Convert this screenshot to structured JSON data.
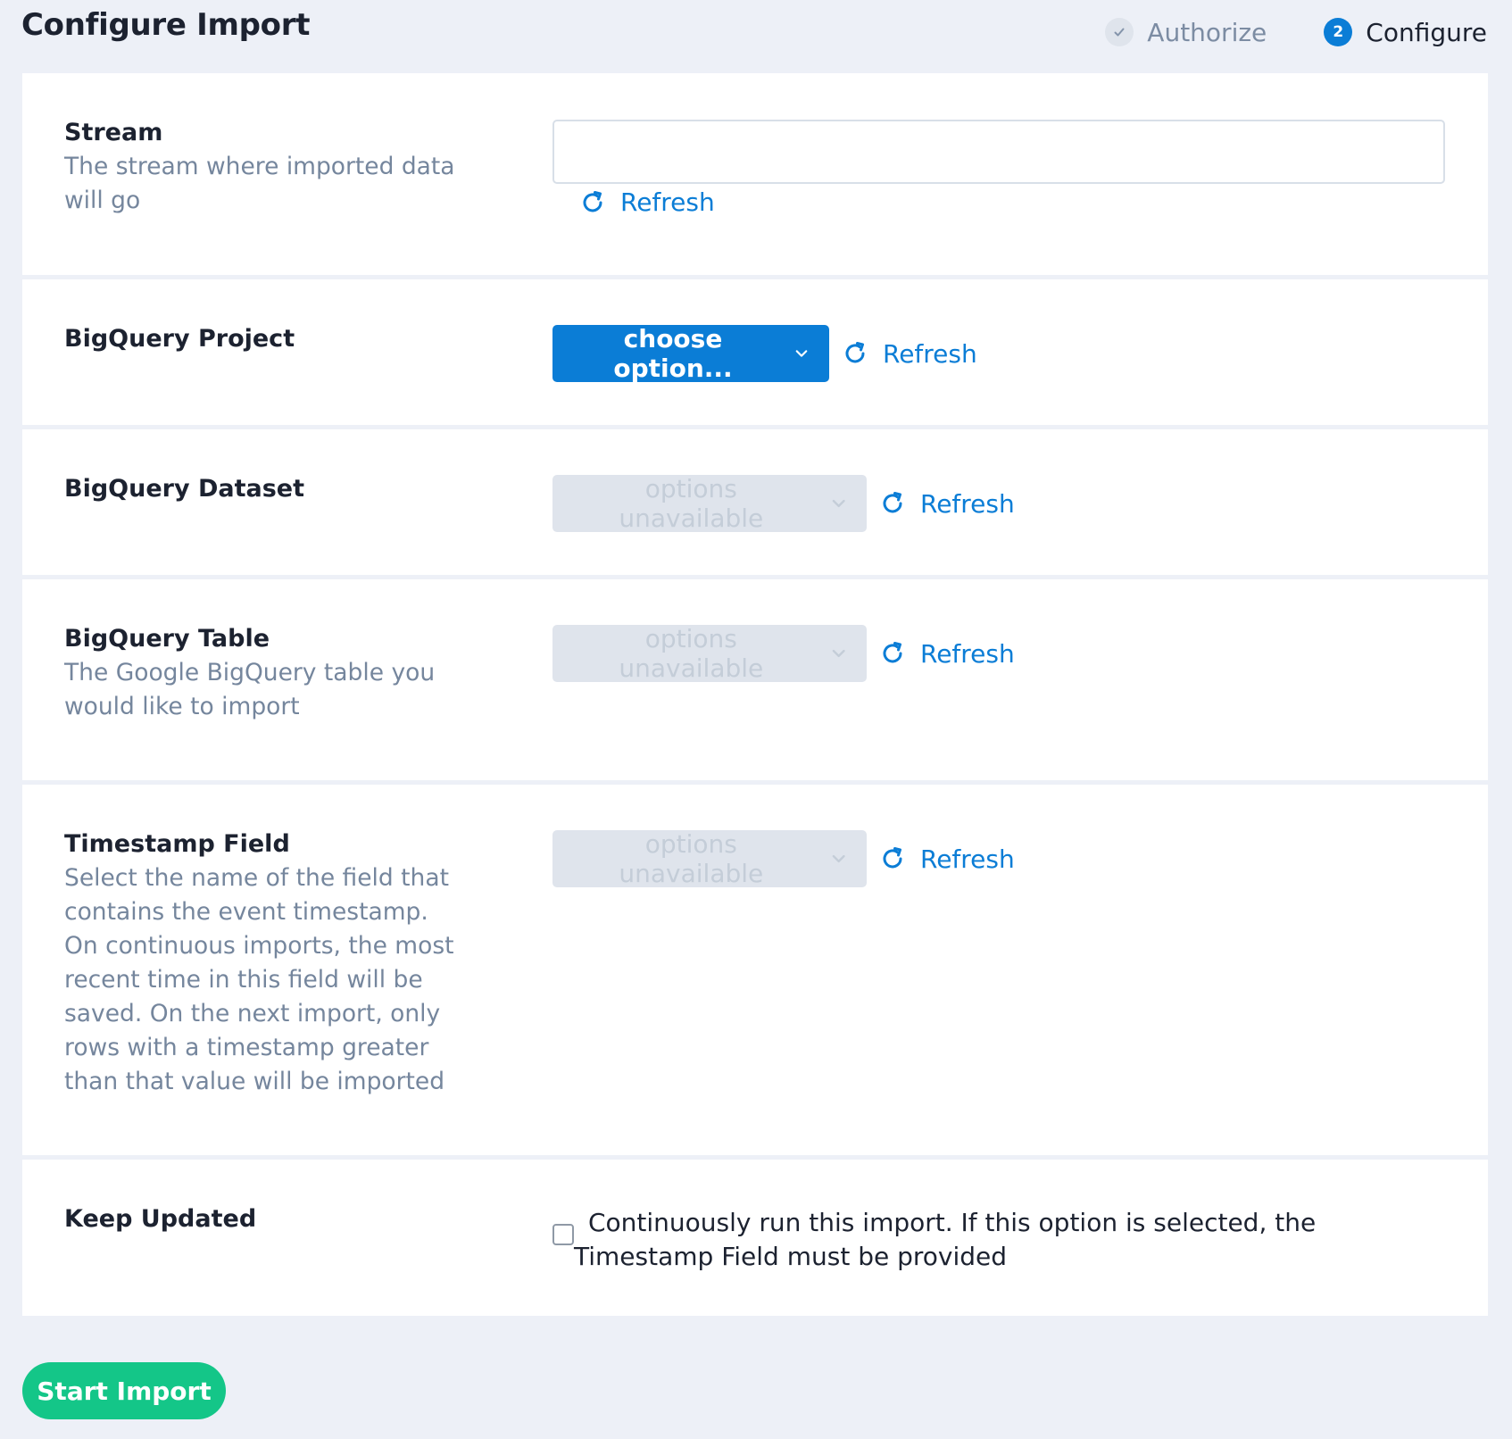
{
  "header": {
    "title": "Configure Import"
  },
  "stepper": {
    "steps": [
      {
        "label": "Authorize",
        "badge": "✓",
        "state": "done"
      },
      {
        "label": "Configure",
        "badge": "2",
        "state": "active"
      }
    ]
  },
  "fields": {
    "stream": {
      "title": "Stream",
      "description": "The stream where imported data will go",
      "value": "",
      "refresh_label": "Refresh"
    },
    "project": {
      "title": "BigQuery Project",
      "select_label": "choose option...",
      "refresh_label": "Refresh"
    },
    "dataset": {
      "title": "BigQuery Dataset",
      "select_label": "options unavailable",
      "refresh_label": "Refresh"
    },
    "table": {
      "title": "BigQuery Table",
      "description": "The Google BigQuery table you would like to import",
      "select_label": "options unavailable",
      "refresh_label": "Refresh"
    },
    "timestamp": {
      "title": "Timestamp Field",
      "description": "Select the name of the field that contains the event timestamp. On continuous imports, the most recent time in this field will be saved. On the next import, only rows with a timestamp greater than that value will be imported",
      "select_label": "options unavailable",
      "refresh_label": "Refresh"
    },
    "keep_updated": {
      "title": "Keep Updated",
      "checkbox_label": "Continuously run this import. If this option is selected, the Timestamp Field must be provided",
      "checked": false
    }
  },
  "actions": {
    "start_label": "Start Import"
  },
  "colors": {
    "accent": "#0b7dd6",
    "success": "#14c688",
    "page_bg": "#edf0f7",
    "muted_text": "#75869d"
  }
}
